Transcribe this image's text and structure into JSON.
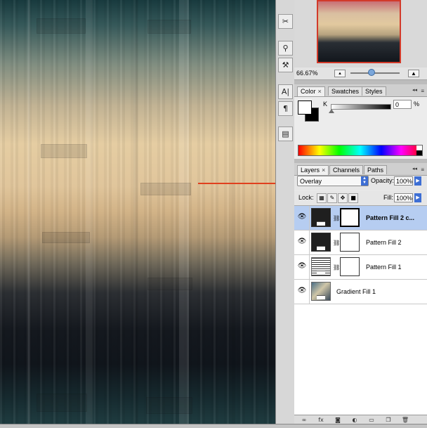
{
  "navigator": {
    "zoom": "66.67%",
    "thumb_colors": {
      "frame": "#d23a2a"
    }
  },
  "tools": [
    {
      "name": "crossed-tools-icon",
      "glyph": "✂"
    },
    {
      "name": "stamp-icon",
      "glyph": "⚲"
    },
    {
      "name": "history-brush-icon",
      "glyph": "⚒"
    },
    {
      "name": "type-tool-icon",
      "glyph": "A|"
    },
    {
      "name": "paragraph-icon",
      "glyph": "¶"
    },
    {
      "name": "tool-preset-icon",
      "glyph": "▤"
    }
  ],
  "color_panel": {
    "tabs": [
      "Color",
      "Swatches",
      "Styles"
    ],
    "channel_label": "K",
    "channel_value": "0",
    "unit": "%"
  },
  "layers_panel": {
    "tabs": [
      "Layers",
      "Channels",
      "Paths"
    ],
    "blend_mode": "Overlay",
    "opacity_label": "Opacity:",
    "opacity_value": "100%",
    "lock_label": "Lock:",
    "fill_label": "Fill:",
    "fill_value": "100%",
    "layers": [
      {
        "name": "Pattern Fill 2 c...",
        "selected": true,
        "thumb": "black",
        "has_mask": true
      },
      {
        "name": "Pattern Fill 2",
        "selected": false,
        "thumb": "black",
        "has_mask": true
      },
      {
        "name": "Pattern Fill 1",
        "selected": false,
        "thumb": "pattern",
        "has_mask": true
      },
      {
        "name": "Gradient Fill 1",
        "selected": false,
        "thumb": "gradient",
        "has_mask": false
      }
    ],
    "bottom_buttons": [
      "link-icon",
      "fx-icon",
      "add-mask-icon",
      "adjustment-layer-icon",
      "new-group-icon",
      "new-layer-icon",
      "trash-icon"
    ]
  },
  "colors": {
    "selection": "#b6cdf1",
    "accent": "#3d6ed4",
    "arrow": "#e0401e"
  }
}
